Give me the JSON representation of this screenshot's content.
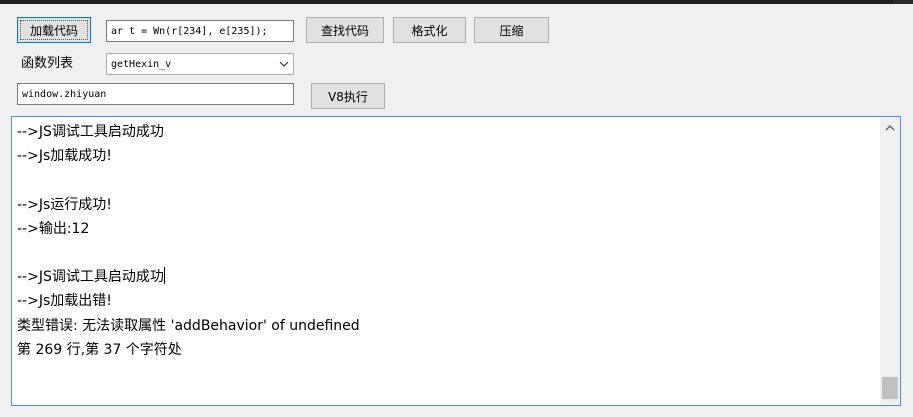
{
  "toolbar": {
    "load_code": "加载代码",
    "code_input_value": "ar t = Wn(r[234], e[235]);",
    "find_code": "查找代码",
    "format": "格式化",
    "compress": "压缩"
  },
  "functions": {
    "label": "函数列表",
    "selected": "getHexin_v"
  },
  "expression": {
    "value": "window.zhiyuan",
    "run_label": "V8执行"
  },
  "console": {
    "lines": [
      "-->JS调试工具启动成功",
      "-->Js加载成功!",
      "",
      "-->Js运行成功!",
      "-->输出:12",
      "",
      "-->JS调试工具启动成功",
      "-->Js加载出错!",
      "类型错误: 无法读取属性 'addBehavior' of undefined",
      "第 269 行,第 37 个字符处"
    ]
  },
  "colors": {
    "accent": "#0078d7",
    "button_face": "#e1e1e1",
    "window_bg": "#f0f0f0"
  }
}
